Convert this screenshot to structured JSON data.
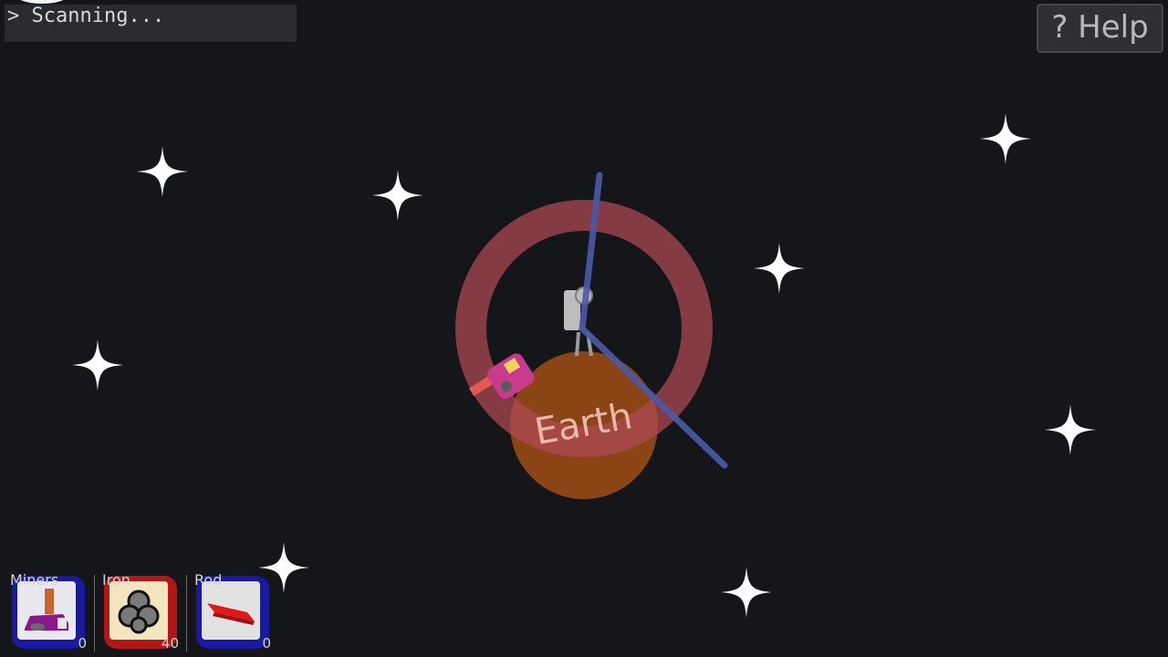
{
  "console": {
    "text": "> Scanning..."
  },
  "help": {
    "label": "? Help"
  },
  "planet": {
    "name": "Earth",
    "color": "#8a4416"
  },
  "orbit_color": "#a04a52",
  "beam_color": "#4a5aa8",
  "inventory": [
    {
      "label": "Miners",
      "count": "0",
      "frame_color": "#1a1aa0",
      "icon": "miner-icon"
    },
    {
      "label": "Iron",
      "count": "40",
      "frame_color": "#b01818",
      "icon": "iron-ore-icon"
    },
    {
      "label": "Rod",
      "count": "0",
      "frame_color": "#1a1aa0",
      "icon": "rod-icon"
    }
  ]
}
